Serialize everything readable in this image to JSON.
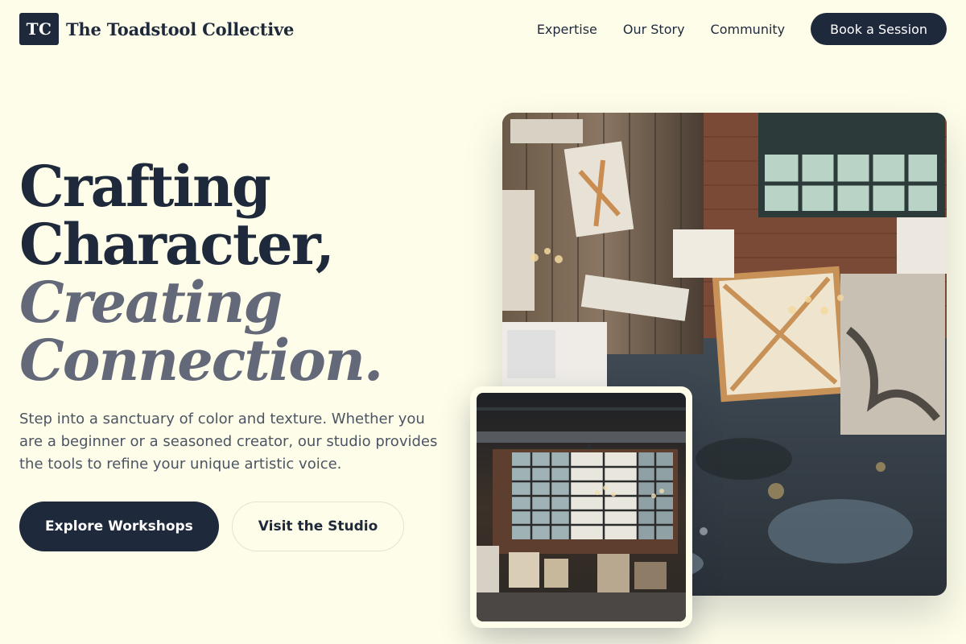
{
  "header": {
    "logo_text": "TC",
    "brand_name": "The Toadstool Collective",
    "nav": [
      "Expertise",
      "Our Story",
      "Community"
    ],
    "cta_label": "Book a Session"
  },
  "hero": {
    "title_line1": "Crafting",
    "title_line2": "Character,",
    "title_line3": "Creating",
    "title_line4": "Connection.",
    "subtitle": "Step into a sanctuary of color and texture. Whether you are a beginner or a seasoned creator, our studio provides the tools to refine your unique artistic voice.",
    "primary_button": "Explore Workshops",
    "secondary_button": "Visit the Studio"
  },
  "colors": {
    "background": "#fefde9",
    "navy": "#1e293b",
    "accent_gray": "#64697a",
    "body_text": "#4b5563"
  },
  "images": {
    "main": "art-studio-loft-photo",
    "inset": "warehouse-studio-photo"
  }
}
